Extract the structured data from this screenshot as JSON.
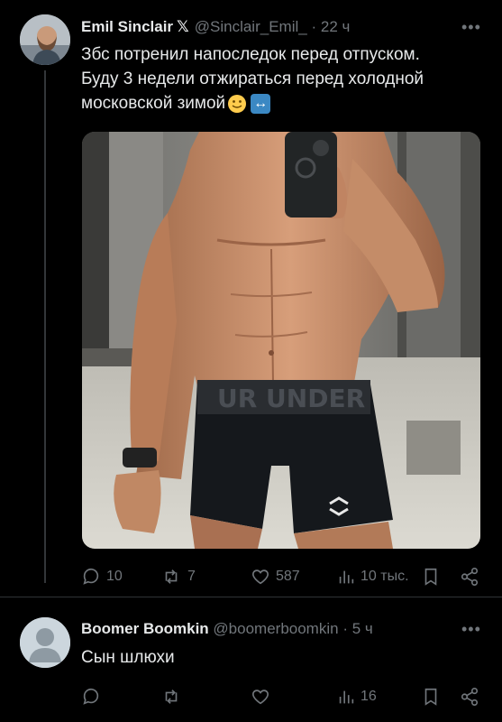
{
  "tweet": {
    "author_name": "Emil Sinclair",
    "x_glyph": "𝕏",
    "handle": "@Sinclair_Emil_",
    "sep": "·",
    "time": "22 ч",
    "more": "•••",
    "lines": [
      "Збс потренил напоследок перед отпуском.",
      "Буду 3 недели отжираться перед холодной",
      "московской зимой"
    ],
    "emoji_1": "🙂",
    "emoji_2": "↔",
    "stats": {
      "replies": "10",
      "reposts": "7",
      "likes": "587",
      "views": "10 тыс."
    }
  },
  "reply": {
    "author_name": "Boomer Boomkin",
    "handle": "@boomerboomkin",
    "sep": "·",
    "time": "5 ч",
    "more": "•••",
    "text": "Сын шлюхи",
    "stats": {
      "views": "16"
    }
  },
  "colors": {
    "background": "#000000",
    "text": "#e7e9ea",
    "muted": "#71767b",
    "divider": "#2f3336"
  }
}
